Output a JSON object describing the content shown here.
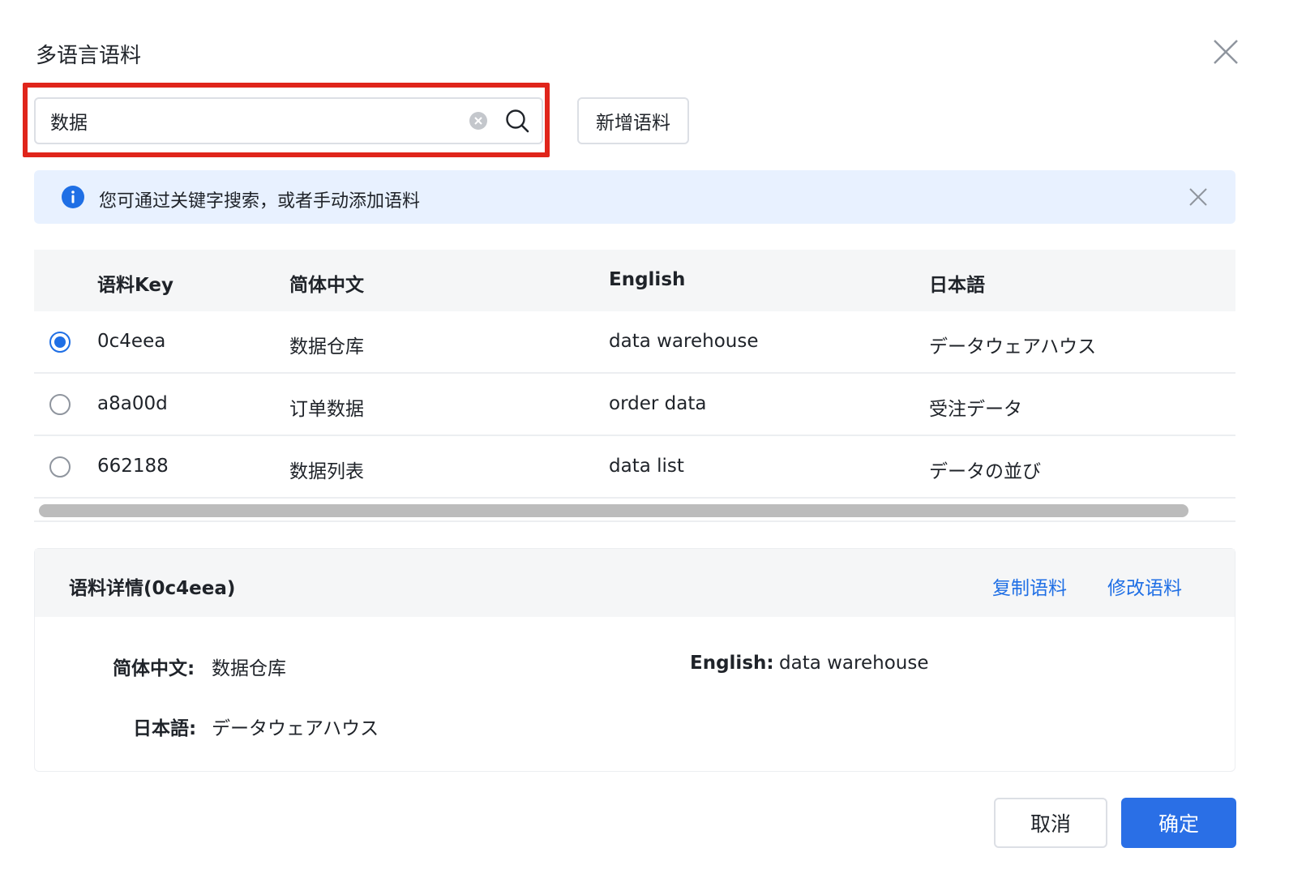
{
  "dialog": {
    "title": "多语言语料"
  },
  "search": {
    "value": "数据",
    "placeholder": ""
  },
  "toolbar": {
    "add_label": "新增语料"
  },
  "alert": {
    "text": "您可通过关键字搜索，或者手动添加语料"
  },
  "table": {
    "columns": [
      "语料Key",
      "简体中文",
      "English",
      "日本語"
    ],
    "rows": [
      {
        "key": "0c4eea",
        "zh": "数据仓库",
        "en": "data warehouse",
        "ja": "データウェアハウス",
        "selected": true
      },
      {
        "key": "a8a00d",
        "zh": "订单数据",
        "en": "order data",
        "ja": "受注データ",
        "selected": false
      },
      {
        "key": "662188",
        "zh": "数据列表",
        "en": "data list",
        "ja": "データの並び",
        "selected": false
      }
    ]
  },
  "detail": {
    "title": "语料详情(0c4eea)",
    "copy_label": "复制语料",
    "edit_label": "修改语料",
    "zh_label": "简体中文:",
    "zh_value": "数据仓库",
    "en_label": "English:",
    "en_value": "data warehouse",
    "ja_label": "日本語:",
    "ja_value": "データウェアハウス"
  },
  "footer": {
    "cancel_label": "取消",
    "ok_label": "确定"
  },
  "colors": {
    "accent": "#1f6fe5",
    "primary_button": "#2a6fe6",
    "highlight_border": "#e0251b",
    "alert_bg": "#e8f1ff"
  },
  "icons": {
    "close": "close-icon",
    "clear": "clear-circle-icon",
    "search": "search-icon",
    "info": "info-icon",
    "alert_close": "close-icon"
  }
}
